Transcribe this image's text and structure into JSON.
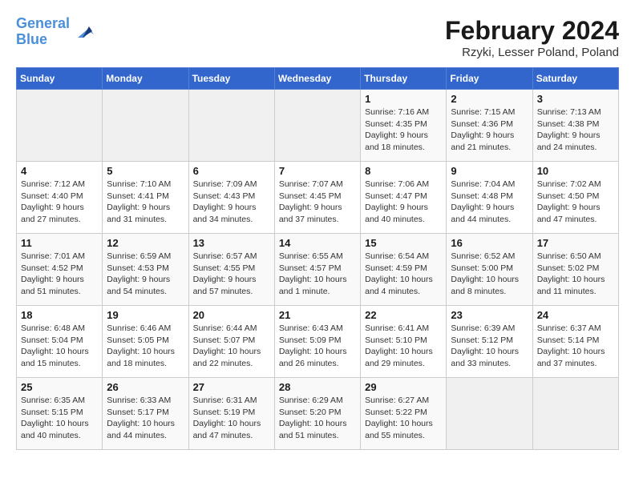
{
  "header": {
    "logo_line1": "General",
    "logo_line2": "Blue",
    "title": "February 2024",
    "subtitle": "Rzyki, Lesser Poland, Poland"
  },
  "days_of_week": [
    "Sunday",
    "Monday",
    "Tuesday",
    "Wednesday",
    "Thursday",
    "Friday",
    "Saturday"
  ],
  "weeks": [
    [
      {
        "day": "",
        "info": ""
      },
      {
        "day": "",
        "info": ""
      },
      {
        "day": "",
        "info": ""
      },
      {
        "day": "",
        "info": ""
      },
      {
        "day": "1",
        "info": "Sunrise: 7:16 AM\nSunset: 4:35 PM\nDaylight: 9 hours\nand 18 minutes."
      },
      {
        "day": "2",
        "info": "Sunrise: 7:15 AM\nSunset: 4:36 PM\nDaylight: 9 hours\nand 21 minutes."
      },
      {
        "day": "3",
        "info": "Sunrise: 7:13 AM\nSunset: 4:38 PM\nDaylight: 9 hours\nand 24 minutes."
      }
    ],
    [
      {
        "day": "4",
        "info": "Sunrise: 7:12 AM\nSunset: 4:40 PM\nDaylight: 9 hours\nand 27 minutes."
      },
      {
        "day": "5",
        "info": "Sunrise: 7:10 AM\nSunset: 4:41 PM\nDaylight: 9 hours\nand 31 minutes."
      },
      {
        "day": "6",
        "info": "Sunrise: 7:09 AM\nSunset: 4:43 PM\nDaylight: 9 hours\nand 34 minutes."
      },
      {
        "day": "7",
        "info": "Sunrise: 7:07 AM\nSunset: 4:45 PM\nDaylight: 9 hours\nand 37 minutes."
      },
      {
        "day": "8",
        "info": "Sunrise: 7:06 AM\nSunset: 4:47 PM\nDaylight: 9 hours\nand 40 minutes."
      },
      {
        "day": "9",
        "info": "Sunrise: 7:04 AM\nSunset: 4:48 PM\nDaylight: 9 hours\nand 44 minutes."
      },
      {
        "day": "10",
        "info": "Sunrise: 7:02 AM\nSunset: 4:50 PM\nDaylight: 9 hours\nand 47 minutes."
      }
    ],
    [
      {
        "day": "11",
        "info": "Sunrise: 7:01 AM\nSunset: 4:52 PM\nDaylight: 9 hours\nand 51 minutes."
      },
      {
        "day": "12",
        "info": "Sunrise: 6:59 AM\nSunset: 4:53 PM\nDaylight: 9 hours\nand 54 minutes."
      },
      {
        "day": "13",
        "info": "Sunrise: 6:57 AM\nSunset: 4:55 PM\nDaylight: 9 hours\nand 57 minutes."
      },
      {
        "day": "14",
        "info": "Sunrise: 6:55 AM\nSunset: 4:57 PM\nDaylight: 10 hours\nand 1 minute."
      },
      {
        "day": "15",
        "info": "Sunrise: 6:54 AM\nSunset: 4:59 PM\nDaylight: 10 hours\nand 4 minutes."
      },
      {
        "day": "16",
        "info": "Sunrise: 6:52 AM\nSunset: 5:00 PM\nDaylight: 10 hours\nand 8 minutes."
      },
      {
        "day": "17",
        "info": "Sunrise: 6:50 AM\nSunset: 5:02 PM\nDaylight: 10 hours\nand 11 minutes."
      }
    ],
    [
      {
        "day": "18",
        "info": "Sunrise: 6:48 AM\nSunset: 5:04 PM\nDaylight: 10 hours\nand 15 minutes."
      },
      {
        "day": "19",
        "info": "Sunrise: 6:46 AM\nSunset: 5:05 PM\nDaylight: 10 hours\nand 18 minutes."
      },
      {
        "day": "20",
        "info": "Sunrise: 6:44 AM\nSunset: 5:07 PM\nDaylight: 10 hours\nand 22 minutes."
      },
      {
        "day": "21",
        "info": "Sunrise: 6:43 AM\nSunset: 5:09 PM\nDaylight: 10 hours\nand 26 minutes."
      },
      {
        "day": "22",
        "info": "Sunrise: 6:41 AM\nSunset: 5:10 PM\nDaylight: 10 hours\nand 29 minutes."
      },
      {
        "day": "23",
        "info": "Sunrise: 6:39 AM\nSunset: 5:12 PM\nDaylight: 10 hours\nand 33 minutes."
      },
      {
        "day": "24",
        "info": "Sunrise: 6:37 AM\nSunset: 5:14 PM\nDaylight: 10 hours\nand 37 minutes."
      }
    ],
    [
      {
        "day": "25",
        "info": "Sunrise: 6:35 AM\nSunset: 5:15 PM\nDaylight: 10 hours\nand 40 minutes."
      },
      {
        "day": "26",
        "info": "Sunrise: 6:33 AM\nSunset: 5:17 PM\nDaylight: 10 hours\nand 44 minutes."
      },
      {
        "day": "27",
        "info": "Sunrise: 6:31 AM\nSunset: 5:19 PM\nDaylight: 10 hours\nand 47 minutes."
      },
      {
        "day": "28",
        "info": "Sunrise: 6:29 AM\nSunset: 5:20 PM\nDaylight: 10 hours\nand 51 minutes."
      },
      {
        "day": "29",
        "info": "Sunrise: 6:27 AM\nSunset: 5:22 PM\nDaylight: 10 hours\nand 55 minutes."
      },
      {
        "day": "",
        "info": ""
      },
      {
        "day": "",
        "info": ""
      }
    ]
  ]
}
